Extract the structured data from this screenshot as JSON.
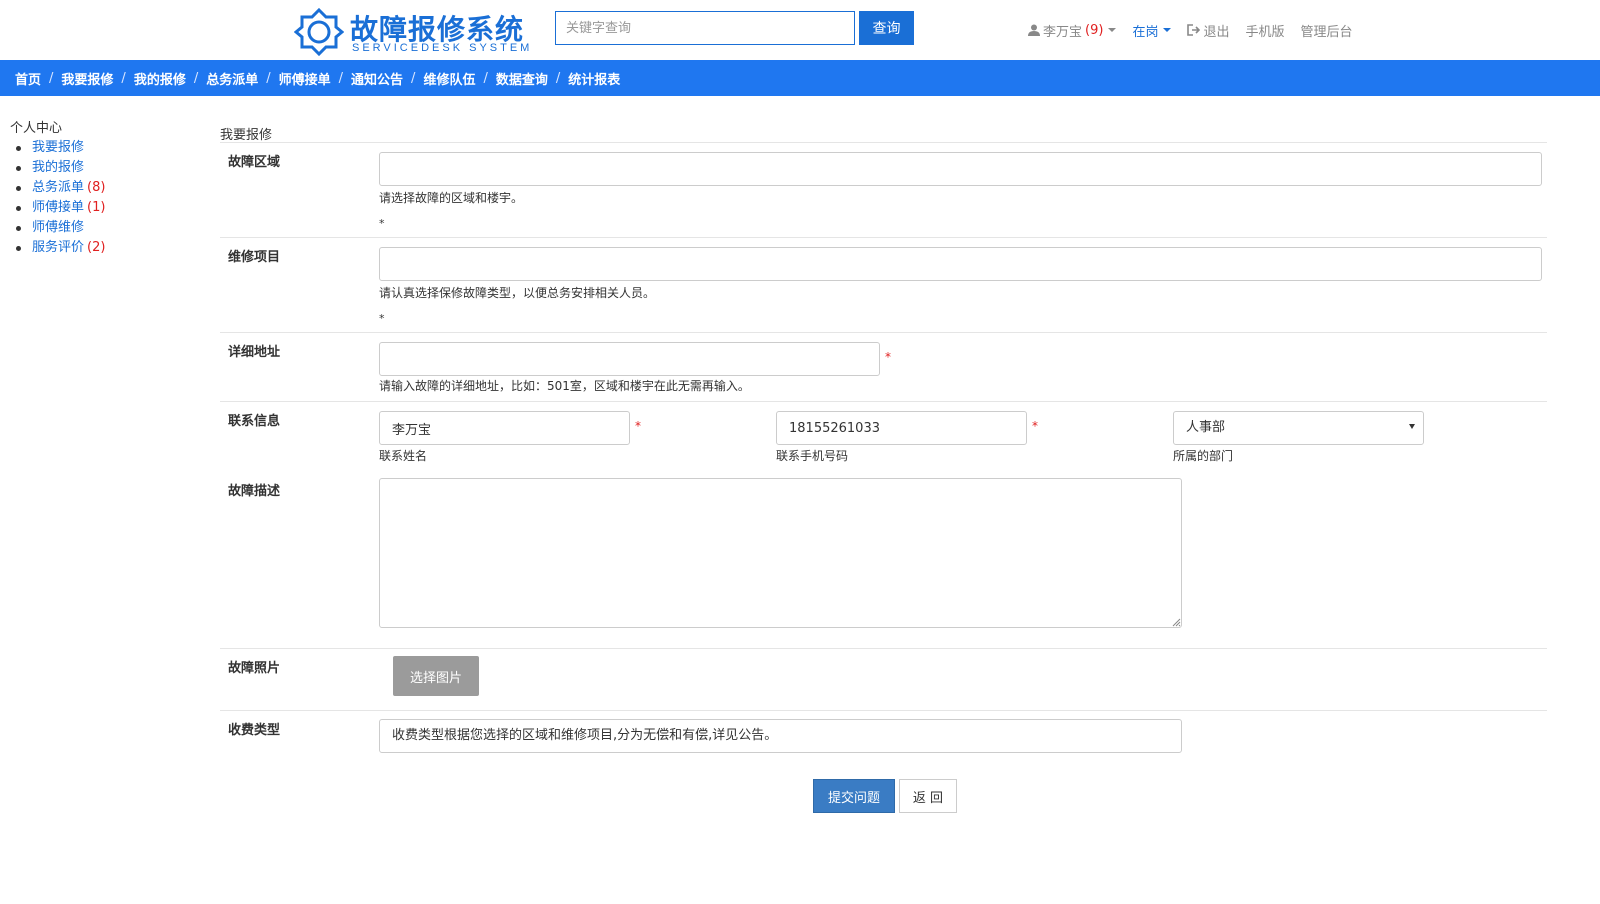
{
  "header": {
    "logo_title": "故障报修系统",
    "logo_subtitle": "SERVICEDESK SYSTEM",
    "search_placeholder": "关键字查询",
    "search_button": "查询",
    "user_name": "李万宝",
    "user_count": "(9)",
    "status": "在岗",
    "logout": "退出",
    "mobile": "手机版",
    "admin": "管理后台"
  },
  "nav": {
    "items": [
      "首页",
      "我要报修",
      "我的报修",
      "总务派单",
      "师傅接单",
      "通知公告",
      "维修队伍",
      "数据查询",
      "统计报表"
    ],
    "separator": "/"
  },
  "sidebar": {
    "title": "个人中心",
    "items": [
      {
        "label": "我要报修",
        "count": ""
      },
      {
        "label": "我的报修",
        "count": ""
      },
      {
        "label": "总务派单",
        "count": "(8)"
      },
      {
        "label": "师傅接单",
        "count": "(1)"
      },
      {
        "label": "师傅维修",
        "count": ""
      },
      {
        "label": "服务评价",
        "count": "(2)"
      }
    ]
  },
  "form": {
    "heading": "我要报修",
    "area": {
      "label": "故障区域",
      "help": "请选择故障的区域和楼宇。",
      "mark": "*",
      "value": ""
    },
    "item": {
      "label": "维修项目",
      "help": "请认真选择保修故障类型，以便总务安排相关人员。",
      "mark": "*",
      "value": ""
    },
    "address": {
      "label": "详细地址",
      "help": "请输入故障的详细地址，比如：501室，区域和楼宇在此无需再输入。",
      "required": "*",
      "value": ""
    },
    "contact": {
      "label": "联系信息",
      "name_value": "李万宝",
      "name_help": "联系姓名",
      "phone_value": "18155261033",
      "phone_help": "联系手机号码",
      "dept_value": "人事部",
      "dept_help": "所属的部门",
      "required": "*"
    },
    "description": {
      "label": "故障描述",
      "value": ""
    },
    "photo": {
      "label": "故障照片",
      "button": "选择图片"
    },
    "fee": {
      "label": "收费类型",
      "value": "收费类型根据您选择的区域和维修项目,分为无偿和有偿,详见公告。"
    },
    "submit": "提交问题",
    "back": "返 回"
  },
  "colors": {
    "brand": "#1a6fd6",
    "navbar": "#1f77f0",
    "count_red": "#e02020",
    "submit": "#3a7cc4",
    "pick_button": "#9b9b9b"
  },
  "icons": [
    "logo-hexagon-icon",
    "user-icon",
    "logout-icon",
    "chevron-down-icon",
    "select-arrow-icon",
    "resize-grip-icon"
  ]
}
